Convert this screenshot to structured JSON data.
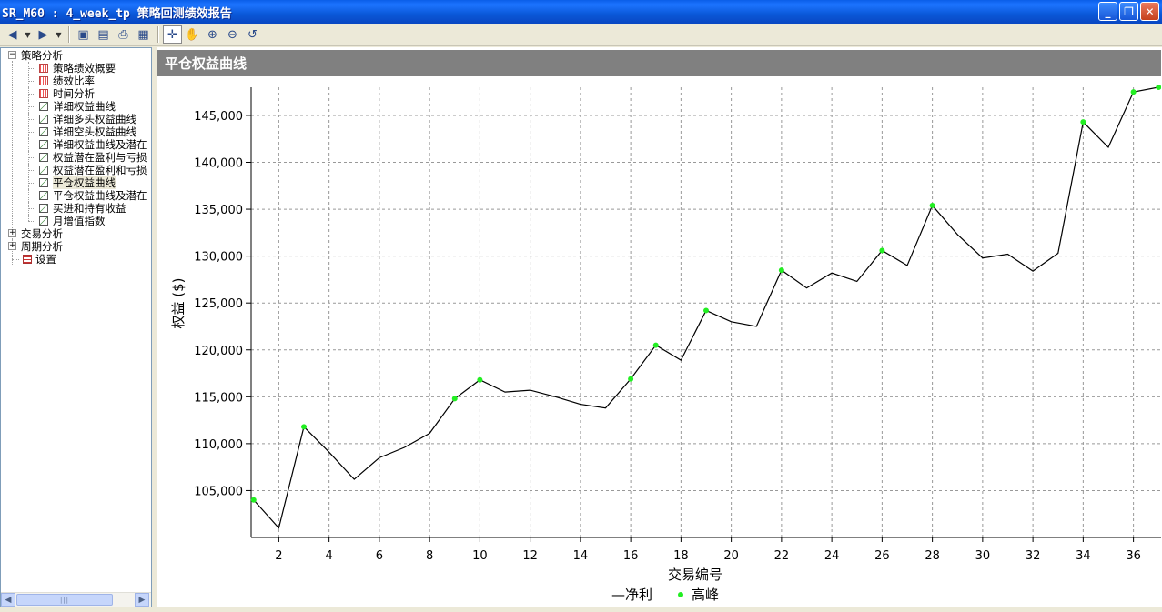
{
  "window": {
    "title": "SR_M60 : 4_week_tp 策略回测绩效报告",
    "buttons": {
      "minimize": "_",
      "restore": "❐",
      "close": "✕"
    }
  },
  "toolbar": {
    "buttons": [
      "back-icon",
      "forward-icon",
      "save-icon",
      "preview-icon",
      "print-icon",
      "layout-icon",
      "crosshair-icon",
      "hand-icon",
      "zoom-in-icon",
      "zoom-out-icon",
      "reset-icon"
    ]
  },
  "tree": {
    "root1": "策略分析",
    "items": [
      "策略绩效概要",
      "绩效比率",
      "时间分析",
      "详细权益曲线",
      "详细多头权益曲线",
      "详细空头权益曲线",
      "详细权益曲线及潜在",
      "权益潜在盈利与亏损",
      "权益潜在盈利和亏损",
      "平仓权益曲线",
      "平仓权益曲线及潜在",
      "买进和持有收益",
      "月增值指数"
    ],
    "root2": "交易分析",
    "root3": "周期分析",
    "settings": "设置",
    "selected_index": 9
  },
  "panel": {
    "header": "平仓权益曲线"
  },
  "chart_data": {
    "type": "line",
    "title": "",
    "xlabel": "交易编号",
    "ylabel": "权益 ($)",
    "xlim": [
      0.9,
      37.1
    ],
    "ylim": [
      100000,
      148000
    ],
    "x_ticks": [
      2,
      4,
      6,
      8,
      10,
      12,
      14,
      16,
      18,
      20,
      22,
      24,
      26,
      28,
      30,
      32,
      34,
      36
    ],
    "y_ticks": [
      105000,
      110000,
      115000,
      120000,
      125000,
      130000,
      135000,
      140000,
      145000
    ],
    "y_tick_labels": [
      "105,000",
      "110,000",
      "115,000",
      "120,000",
      "125,000",
      "130,000",
      "135,000",
      "140,000",
      "145,000"
    ],
    "grid": true,
    "legend": [
      "—净利",
      "高峰"
    ],
    "legend_position": "bottom",
    "series": [
      {
        "name": "净利",
        "color": "#000000",
        "x": [
          1,
          2,
          3,
          4,
          5,
          6,
          7,
          8,
          9,
          10,
          11,
          12,
          13,
          14,
          15,
          16,
          17,
          18,
          19,
          20,
          21,
          22,
          23,
          24,
          25,
          26,
          27,
          28,
          29,
          30,
          31,
          32,
          33,
          34,
          35,
          36,
          37
        ],
        "y": [
          104000,
          101000,
          111800,
          109100,
          106200,
          108500,
          109600,
          111100,
          114800,
          116800,
          115500,
          115700,
          115000,
          114200,
          113800,
          116900,
          120500,
          118900,
          124200,
          123000,
          122500,
          128500,
          126600,
          128200,
          127300,
          130600,
          129000,
          135400,
          132300,
          129800,
          130200,
          128400,
          130300,
          144300,
          141600,
          147500,
          148000
        ]
      },
      {
        "name": "高峰",
        "color": "#22ee22",
        "x": [
          1,
          3,
          9,
          10,
          16,
          17,
          19,
          22,
          26,
          28,
          34,
          36,
          37
        ],
        "y": [
          104000,
          111800,
          114800,
          116800,
          116900,
          120500,
          124200,
          128500,
          130600,
          135400,
          144300,
          147500,
          148000
        ]
      }
    ]
  }
}
